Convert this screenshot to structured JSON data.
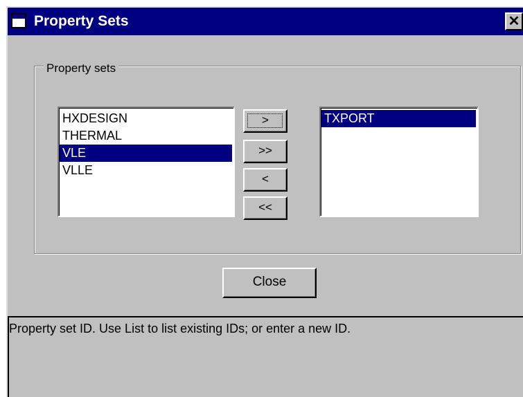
{
  "window": {
    "title": "Property Sets",
    "close_glyph": "✕"
  },
  "group": {
    "label": "Property sets"
  },
  "available_list": {
    "items": [
      "HXDESIGN",
      "THERMAL",
      "VLE",
      "VLLE"
    ],
    "selected": "VLE"
  },
  "selected_list": {
    "items": [
      "TXPORT"
    ],
    "selected": "TXPORT"
  },
  "transfer_buttons": {
    "add": ">",
    "add_all": ">>",
    "remove": "<",
    "remove_all": "<<"
  },
  "close_button": {
    "label": "Close"
  },
  "status_bar": {
    "text": "Property set ID. Use List to list existing IDs; or enter a new ID."
  },
  "colors": {
    "titlebar": "#000080",
    "dialog_face": "#c0c0c0",
    "selection": "#000080"
  }
}
